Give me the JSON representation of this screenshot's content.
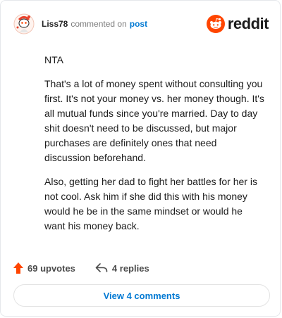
{
  "comment": {
    "username": "Liss78",
    "action_text": "commented on",
    "post_link": "post",
    "brand": "reddit",
    "paragraphs": [
      "NTA",
      "That's a lot of money spent without consulting you first. It's not your money vs. her money though. It's all mutual funds since you're married. Day to day shit doesn't need to be discussed, but major purchases are definitely ones that need discussion beforehand.",
      "Also, getting her dad to fight her battles for her is not cool. Ask him if she did this with his money would he be in the same mindset or would he want his money back."
    ],
    "upvotes": "69 upvotes",
    "replies": "4 replies",
    "view_button": "View 4 comments"
  },
  "icons": {
    "avatar": "avatar-icon",
    "brand": "reddit-snoo-icon",
    "upvote": "upvote-arrow-icon",
    "reply": "reply-arrow-icon"
  },
  "colors": {
    "brand_orange": "#ff4500",
    "link_blue": "#0079d3",
    "upvote_orange": "#ff4500"
  }
}
